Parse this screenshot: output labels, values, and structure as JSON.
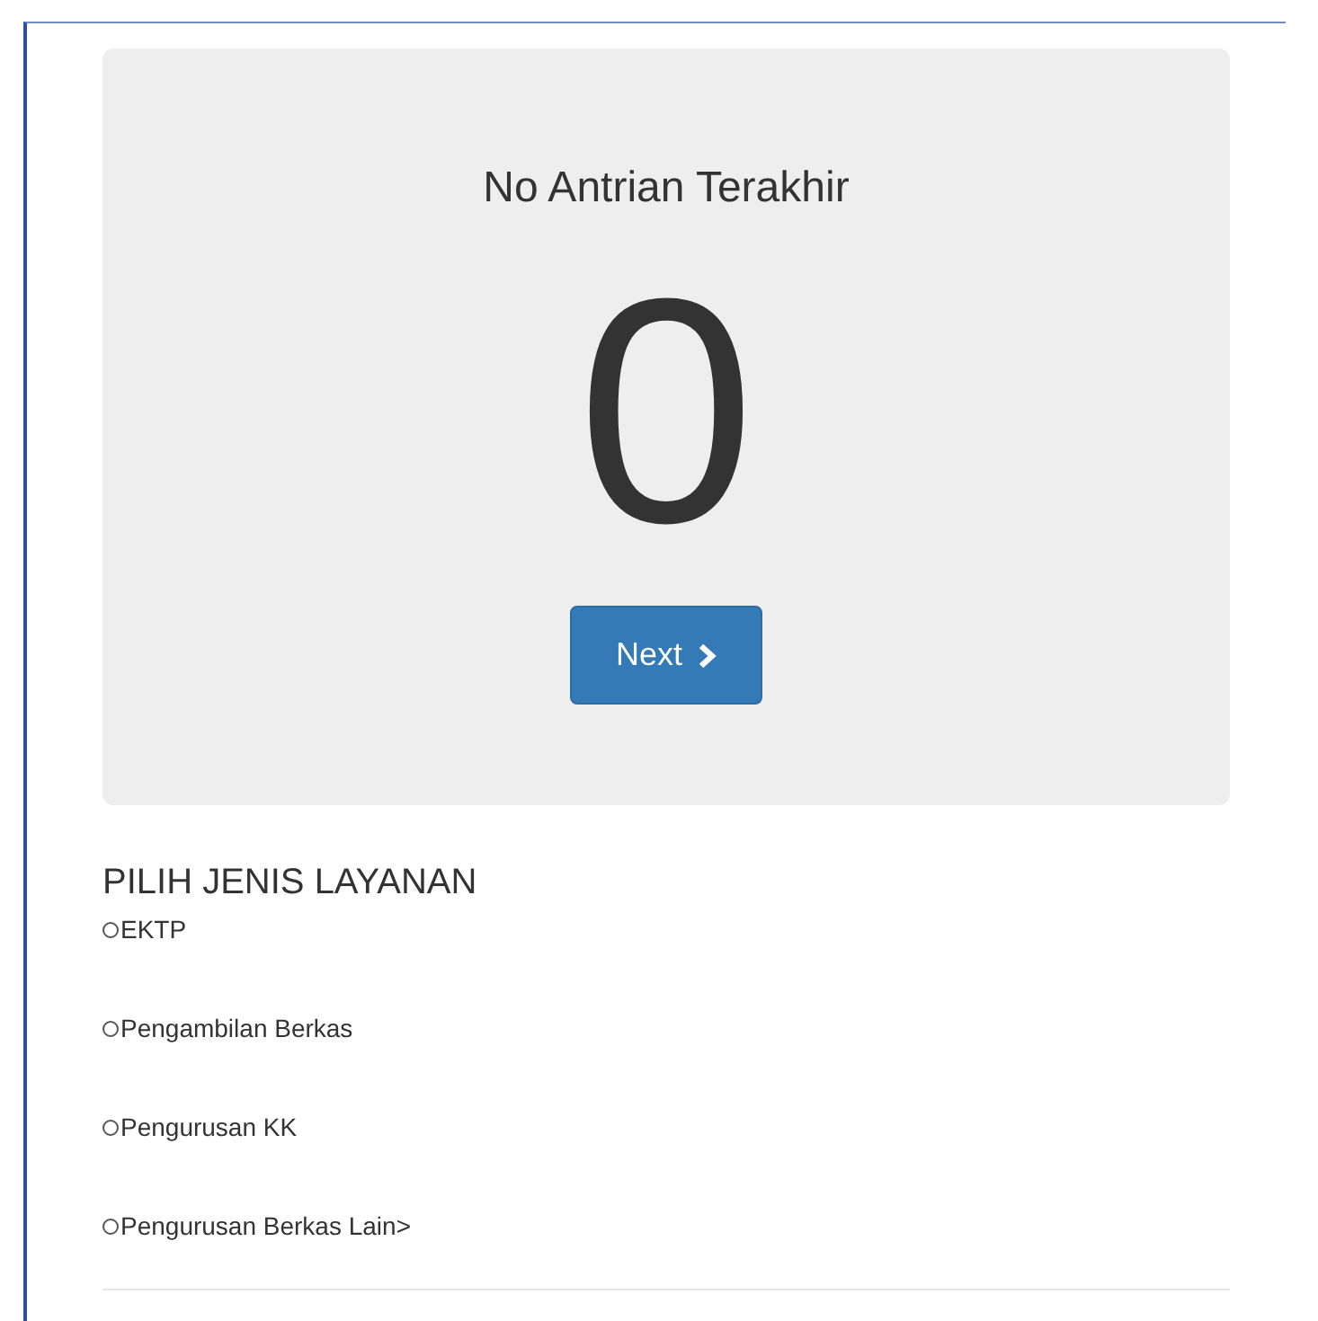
{
  "queue_panel": {
    "title": "No Antrian Terakhir",
    "number": "0",
    "next_button": {
      "label": "Next"
    }
  },
  "service_section": {
    "heading": "PILIH JENIS LAYANAN",
    "options": [
      {
        "label": "EKTP",
        "selected": false
      },
      {
        "label": "Pengambilan Berkas",
        "selected": false
      },
      {
        "label": "Pengurusan KK",
        "selected": false
      },
      {
        "label": "Pengurusan Berkas Lain>",
        "selected": false
      }
    ]
  }
}
